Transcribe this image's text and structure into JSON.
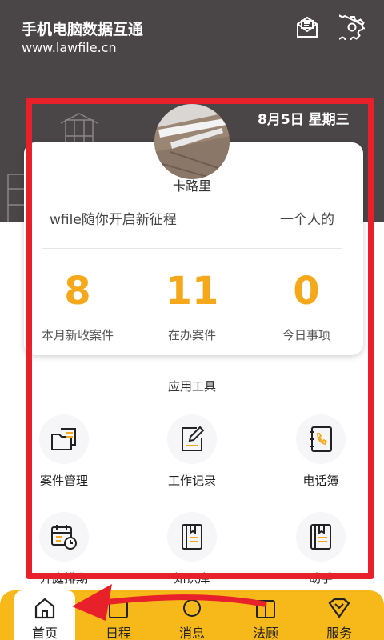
{
  "header": {
    "title": "手机电脑数据互通",
    "url": "www.lawfile.cn",
    "icons": [
      "mail-icon",
      "gear-icon"
    ]
  },
  "date_text": "8月5日 星期三",
  "profile": {
    "name": "卡路里"
  },
  "marquee": {
    "text1": "wfile随你开启新征程",
    "text2": "一个人的"
  },
  "stats": [
    {
      "value": "8",
      "label": "本月新收案件"
    },
    {
      "value": "11",
      "label": "在办案件"
    },
    {
      "value": "0",
      "label": "今日事项"
    }
  ],
  "tools": {
    "section_title": "应用工具",
    "items": [
      {
        "label": "案件管理",
        "icon": "folder-icon"
      },
      {
        "label": "工作记录",
        "icon": "edit-note-icon"
      },
      {
        "label": "电话簿",
        "icon": "phone-book-icon"
      },
      {
        "label": "开庭排期",
        "icon": "calendar-clock-icon"
      },
      {
        "label": "知识库",
        "icon": "book-icon"
      },
      {
        "label": "助手",
        "icon": "assistant-book-icon"
      }
    ]
  },
  "nav": {
    "items": [
      {
        "label": "首页",
        "icon": "home-icon",
        "active": true
      },
      {
        "label": "日程",
        "icon": "schedule-icon"
      },
      {
        "label": "消息",
        "icon": "message-icon"
      },
      {
        "label": "法顾",
        "icon": "legal-advisor-icon"
      },
      {
        "label": "服务",
        "icon": "service-icon"
      }
    ]
  },
  "colors": {
    "header_bg": "#4a4546",
    "accent": "#f5a91a",
    "nav_bg": "#f7b819",
    "annotation": "#e8202a"
  }
}
